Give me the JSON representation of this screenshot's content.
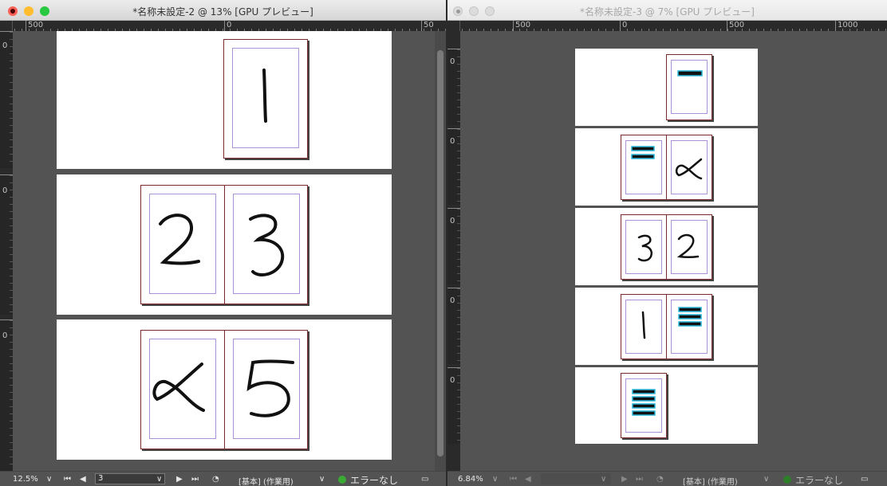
{
  "window1": {
    "title": "*名称未設定-2 @ 13% [GPU プレビュー]",
    "ruler_labels": [
      "500",
      "0",
      "50"
    ],
    "vruler_labels": [
      "0",
      "0",
      "0"
    ],
    "zoom": "12.5%",
    "page_field": "3",
    "profile": "[基本] (作業用)",
    "error_status": "エラーなし",
    "pages": [
      "1",
      "2",
      "3",
      "4",
      "5"
    ]
  },
  "window2": {
    "title": "*名称未設定-3 @ 7% [GPU プレビュー]",
    "ruler_labels": [
      "500",
      "0",
      "500",
      "1000"
    ],
    "vruler_labels": [
      "0",
      "0",
      "0",
      "0",
      "0"
    ],
    "zoom": "6.84%",
    "profile": "[基本] (作業用)",
    "error_status": "エラーなし"
  },
  "icons": {
    "close": "close-button-icon",
    "minimize": "minimize-button-icon",
    "zoom": "zoom-button-icon",
    "first": "first-page-icon",
    "prev": "previous-page-icon",
    "next": "next-page-icon",
    "last": "last-page-icon",
    "dropdown": "chevron-down-icon",
    "preflight": "preflight-icon",
    "panel": "panel-toggle-icon"
  },
  "colors": {
    "close": "#ff5f57",
    "minimize": "#febc2e",
    "zoom": "#28c840",
    "ok": "#3aaa35",
    "page_border": "#7a2a2a",
    "margin_guide": "#a993d6",
    "cyan": "#29b6d8"
  }
}
